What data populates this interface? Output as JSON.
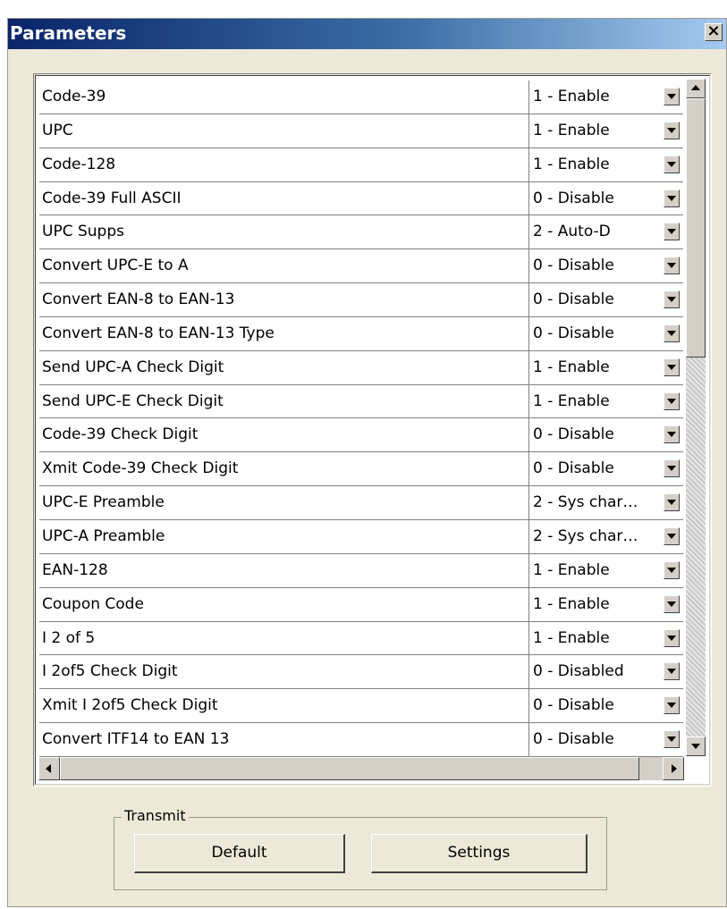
{
  "window": {
    "title": "Parameters",
    "close_label": "×"
  },
  "parameters": [
    {
      "name": "Code-39",
      "value": "1 - Enable"
    },
    {
      "name": "UPC",
      "value": "1 - Enable"
    },
    {
      "name": "Code-128",
      "value": "1 - Enable"
    },
    {
      "name": "Code-39 Full ASCII",
      "value": "0 - Disable"
    },
    {
      "name": "UPC Supps",
      "value": "2 - Auto-D"
    },
    {
      "name": "Convert UPC-E to A",
      "value": "0 - Disable"
    },
    {
      "name": "Convert EAN-8 to EAN-13",
      "value": "0 - Disable"
    },
    {
      "name": "Convert EAN-8 to EAN-13 Type",
      "value": "0 - Disable"
    },
    {
      "name": "Send UPC-A Check Digit",
      "value": "1 - Enable"
    },
    {
      "name": "Send UPC-E Check Digit",
      "value": "1 - Enable"
    },
    {
      "name": "Code-39 Check Digit",
      "value": "0 - Disable"
    },
    {
      "name": "Xmit Code-39 Check Digit",
      "value": "0 - Disable"
    },
    {
      "name": "UPC-E Preamble",
      "value": "2 - Sys char…"
    },
    {
      "name": "UPC-A Preamble",
      "value": "2 - Sys char…"
    },
    {
      "name": "EAN-128",
      "value": "1 - Enable"
    },
    {
      "name": "Coupon Code",
      "value": "1 - Enable"
    },
    {
      "name": "I 2 of 5",
      "value": "1 - Enable"
    },
    {
      "name": "I 2of5 Check Digit",
      "value": "0 - Disabled"
    },
    {
      "name": "Xmit I 2of5 Check Digit",
      "value": "0 - Disable"
    },
    {
      "name": "Convert ITF14 to EAN 13",
      "value": "0 - Disable"
    }
  ],
  "transmit": {
    "legend": "Transmit",
    "default_label": "Default",
    "settings_label": "Settings"
  }
}
